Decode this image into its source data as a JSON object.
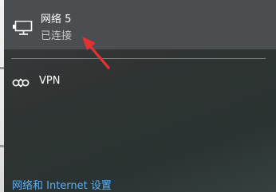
{
  "network": {
    "name": "网络 5",
    "status": "已连接",
    "icon": "wired-network-icon"
  },
  "vpn": {
    "label": "VPN",
    "icon": "vpn-icon"
  },
  "settings_link": {
    "label": "网络和 Internet 设置"
  },
  "colors": {
    "accent_link": "#62aef0",
    "selected_bg": "#4b4e50",
    "annotation_arrow": "#e5312f"
  }
}
